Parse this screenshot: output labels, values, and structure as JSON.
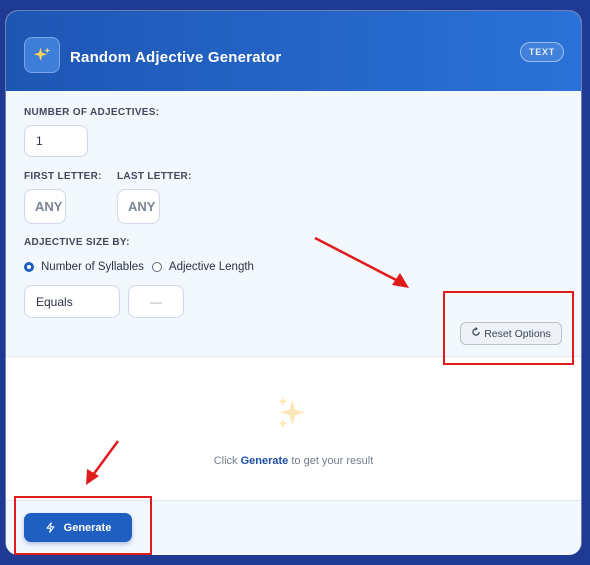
{
  "header": {
    "title": "Random Adjective Generator",
    "badge": "TEXT"
  },
  "options": {
    "count_label": "NUMBER OF ADJECTIVES:",
    "count_value": "1",
    "first_letter_label": "FIRST LETTER:",
    "first_letter_value": "ANY",
    "last_letter_label": "LAST LETTER:",
    "last_letter_value": "ANY",
    "size_by_label": "ADJECTIVE SIZE BY:",
    "size_by_options": [
      "Number of Syllables",
      "Adjective Length"
    ],
    "size_by_selected": "Number of Syllables",
    "comparator_value": "Equals",
    "size_value_placeholder": "—",
    "reset_label": "Reset Options"
  },
  "result": {
    "hint_prefix": "Click",
    "hint_link": "Generate",
    "hint_suffix": "to get your result"
  },
  "footer": {
    "generate_label": "Generate"
  },
  "colors": {
    "header_start": "#1e56b3",
    "header_end": "#2a72d8",
    "accent": "#1e5fc1",
    "annotation": "#e01b1b"
  },
  "icons": {
    "app": "sparkles-icon",
    "result": "sparkles-icon",
    "reset": "refresh-icon",
    "generate": "lightning-icon"
  }
}
